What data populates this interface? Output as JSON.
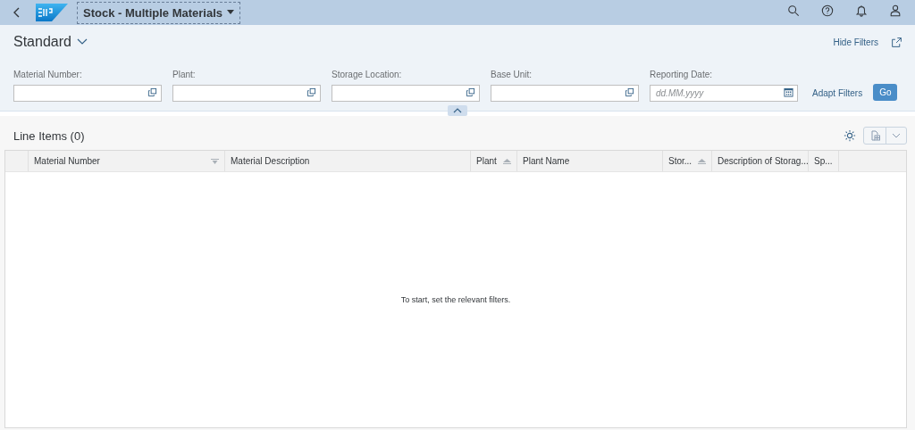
{
  "shell": {
    "title": "Stock - Multiple Materials"
  },
  "variant": {
    "name": "Standard"
  },
  "header_actions": {
    "hide_filters": "Hide Filters"
  },
  "filters": [
    {
      "label": "Material Number:",
      "kind": "value-help"
    },
    {
      "label": "Plant:",
      "kind": "value-help"
    },
    {
      "label": "Storage Location:",
      "kind": "value-help"
    },
    {
      "label": "Base Unit:",
      "kind": "value-help"
    },
    {
      "label": "Reporting Date:",
      "kind": "date",
      "placeholder": "dd.MM.yyyy"
    }
  ],
  "filter_actions": {
    "adapt": "Adapt Filters",
    "go": "Go"
  },
  "table": {
    "title": "Line Items (0)",
    "columns": [
      {
        "label": "Material Number",
        "kind": "filtered"
      },
      {
        "label": "Material Description",
        "kind": "plain"
      },
      {
        "label": "Plant",
        "kind": "sorted"
      },
      {
        "label": "Plant Name",
        "kind": "plain"
      },
      {
        "label": "Stor...",
        "kind": "sorted"
      },
      {
        "label": "Description of Storag...",
        "kind": "plain"
      },
      {
        "label": "Sp...",
        "kind": "plain"
      }
    ],
    "empty_text": "To start, set the relevant filters."
  }
}
